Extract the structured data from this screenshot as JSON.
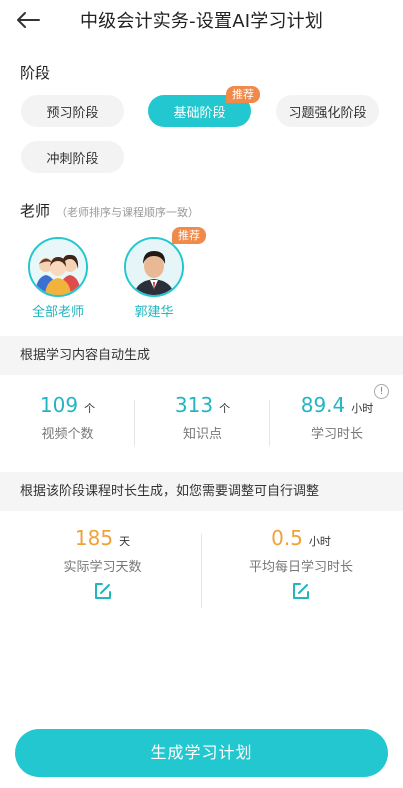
{
  "header": {
    "title": "中级会计实务-设置AI学习计划"
  },
  "stage": {
    "label": "阶段",
    "options": [
      "预习阶段",
      "基础阶段",
      "习题强化阶段",
      "冲刺阶段"
    ],
    "selected": "基础阶段",
    "recommend_badge": "推荐"
  },
  "teacher": {
    "label": "老师",
    "sublabel": "（老师排序与课程顺序一致）",
    "items": [
      {
        "name": "全部老师"
      },
      {
        "name": "郭建华",
        "badge": "推荐"
      }
    ]
  },
  "auto": {
    "title": "根据学习内容自动生成",
    "stats": [
      {
        "value": "109",
        "unit": "个",
        "label": "视频个数"
      },
      {
        "value": "313",
        "unit": "个",
        "label": "知识点"
      },
      {
        "value": "89.4",
        "unit": "小时",
        "label": "学习时长"
      }
    ],
    "color": "#22b6c0"
  },
  "duration": {
    "title": "根据该阶段课程时长生成，如您需要调整可自行调整",
    "stats": [
      {
        "value": "185",
        "unit": "天",
        "label": "实际学习天数"
      },
      {
        "value": "0.5",
        "unit": "小时",
        "label": "平均每日学习时长"
      }
    ],
    "color": "#f0a23a"
  },
  "cta": {
    "label": "生成学习计划"
  },
  "icons": [
    "back-arrow-icon",
    "info-icon",
    "edit-icon"
  ]
}
